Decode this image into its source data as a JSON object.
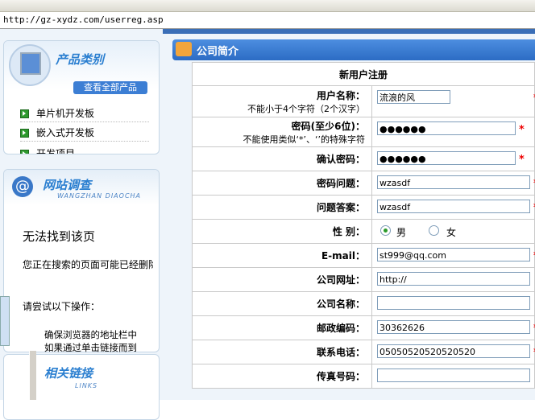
{
  "browser": {
    "url": "http://gz-xydz.com/userreg.asp"
  },
  "left": {
    "product_title": "产品类别",
    "view_all": "查看全部产品",
    "categories": [
      "单片机开发板",
      "嵌入式开发板",
      "开发项目"
    ],
    "survey_title": "网站调查",
    "survey_sub": "WANGZHAN DIAOCHA",
    "links_title": "相关链接",
    "links_sub": "LINKS",
    "error": {
      "title": "无法找到该页",
      "sub": "您正在搜索的页面可能已经删除、",
      "try": "请尝试以下操作：",
      "items": [
        "确保浏览器的地址栏中",
        "如果通过单击链接而到"
      ]
    }
  },
  "section": {
    "title": "公司简介",
    "icon": "book-icon"
  },
  "form": {
    "heading": "新用户注册",
    "rows": [
      {
        "label": "用户名称：",
        "sub": "不能小于4个字符（2个汉字）",
        "value": "流浪的风",
        "required": true
      },
      {
        "label": "密码(至少6位)：",
        "sub": "不能使用类似‘*’、‘’的特殊字符",
        "value": "●●●●●●",
        "required": true
      },
      {
        "label": "确认密码：",
        "value": "●●●●●●",
        "required": true
      },
      {
        "label": "密码问题：",
        "value": "wzasdf",
        "required": true
      },
      {
        "label": "问题答案：",
        "value": "wzasdf",
        "required": true
      },
      {
        "label": "E-mail：",
        "value": "st999@qq.com",
        "required": true
      },
      {
        "label": "公司网址：",
        "value": "http://",
        "required": false
      },
      {
        "label": "公司名称：",
        "value": "",
        "required": false
      },
      {
        "label": "邮政编码：",
        "value": "30362626",
        "required": true
      },
      {
        "label": "联系电话：",
        "value": "05050520520520520",
        "required": true
      },
      {
        "label": "传真号码：",
        "value": "",
        "required": false
      }
    ],
    "gender": {
      "label": "性 别：",
      "male": "男",
      "female": "女",
      "selected": "男"
    },
    "required_mark": "*"
  },
  "colors": {
    "accent": "#2c6cc4",
    "required": "#ee0000",
    "panel_title": "#2b7fd0"
  }
}
